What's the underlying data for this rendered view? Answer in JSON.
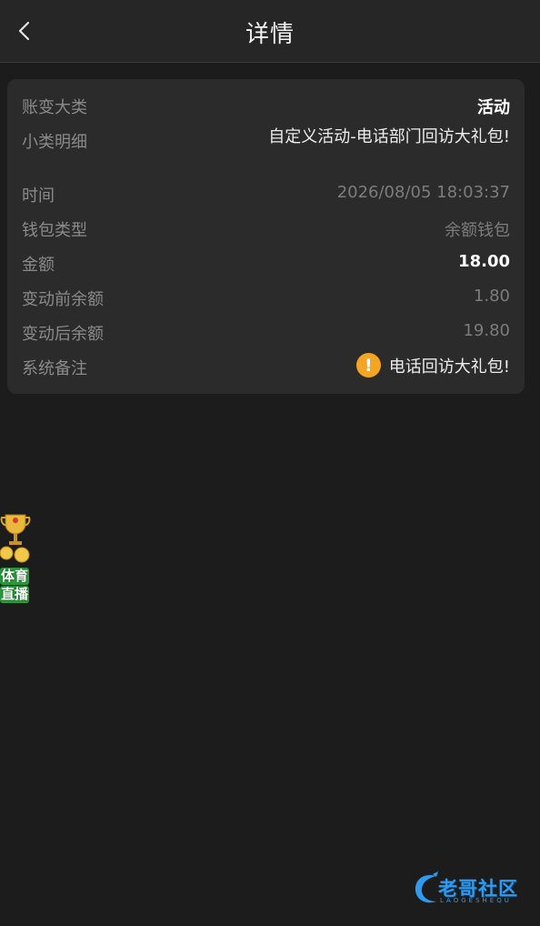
{
  "header": {
    "title": "详情",
    "back_icon": "chevron-left-icon"
  },
  "detail": {
    "rows": [
      {
        "label": "账变大类",
        "value": "活动"
      },
      {
        "label": "小类明细",
        "value": "自定义活动-电话部门回访大礼包!"
      },
      {
        "label": "时间",
        "value": "2026/08/05 18:03:37"
      },
      {
        "label": "钱包类型",
        "value": "余额钱包"
      },
      {
        "label": "金额",
        "value": "18.00"
      },
      {
        "label": "变动前余额",
        "value": "1.80"
      },
      {
        "label": "变动后余额",
        "value": "19.80"
      },
      {
        "label": "系统备注",
        "value": "电话回访大礼包!",
        "icon": "warning-icon"
      }
    ]
  },
  "floating_badge": {
    "line1": "体育",
    "line2": "直播",
    "icon": "trophy-icon"
  },
  "watermark": {
    "text": "老哥社区",
    "subtext": "LAOGESHEQU"
  },
  "colors": {
    "background": "#1c1c1c",
    "card": "#2b2b2b",
    "warning": "#f5a524",
    "watermark": "#2f9bf0"
  }
}
